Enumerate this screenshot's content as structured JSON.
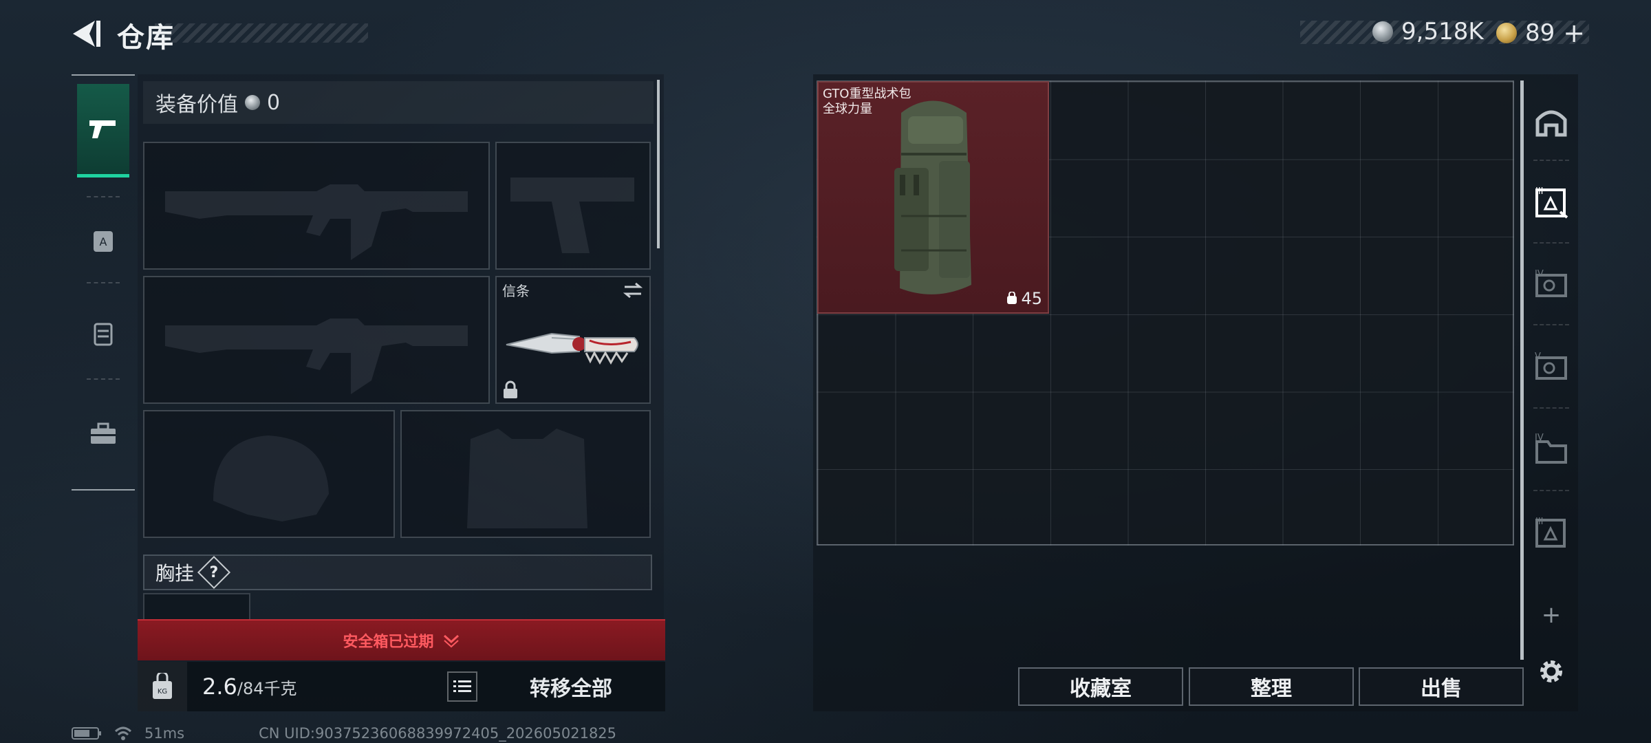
{
  "header": {
    "title": "仓库",
    "currency": [
      {
        "icon": "silver-coin-icon",
        "value": "9,518K"
      },
      {
        "icon": "gold-token-icon",
        "value": "89",
        "suffix": "+"
      }
    ]
  },
  "left_rail": {
    "tabs": [
      {
        "icon": "pistol-icon",
        "active": true
      },
      {
        "icon": "armor-backpack-icon",
        "active": false
      },
      {
        "icon": "vest-icon",
        "active": false
      },
      {
        "icon": "toolbox-icon",
        "active": false
      }
    ]
  },
  "equipment": {
    "value_label": "装备价值",
    "value": "0",
    "melee_slot_label": "信条",
    "chest_label": "胸挂",
    "chest_help": "?"
  },
  "safe_box": {
    "expired_text": "安全箱已过期"
  },
  "bottom_bar": {
    "weight_current": "2.6",
    "weight_max": "/84千克",
    "transfer_all": "转移全部"
  },
  "storage": {
    "item": {
      "name_line1": "GTO重型战术包",
      "name_line2": "全球力量",
      "capacity": "45"
    }
  },
  "right_rail": {
    "items": [
      {
        "icon": "storage-home-icon"
      },
      {
        "icon": "storage-tier-3-icon",
        "selected": true
      },
      {
        "icon": "storage-tier-4-icon"
      },
      {
        "icon": "storage-tier-5-icon"
      },
      {
        "icon": "storage-tier-4-b-icon"
      },
      {
        "icon": "storage-tier-3-b-icon"
      }
    ],
    "add_symbol": "+"
  },
  "actions": {
    "collection": "收藏室",
    "organize": "整理",
    "sell": "出售"
  },
  "status_bar": {
    "ping": "51ms",
    "uid": "CN UID:90375236068839972405_202605021825"
  }
}
